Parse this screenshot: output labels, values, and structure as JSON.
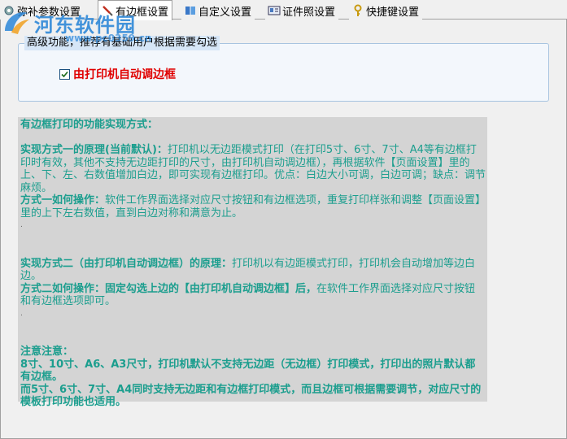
{
  "tabs": [
    {
      "label": "弥补参数设置",
      "icon": "settings-icon"
    },
    {
      "label": "有边框设置",
      "icon": "brush-icon",
      "active": true
    },
    {
      "label": "自定义设置",
      "icon": "book-icon"
    },
    {
      "label": "证件照设置",
      "icon": "id-card-icon"
    },
    {
      "label": "快捷键设置",
      "icon": "key-icon"
    }
  ],
  "watermark": {
    "text": "河东软件园",
    "url": "www.pc0359.cn"
  },
  "group": {
    "title": "高级功能，推荐有基础用户根据需要勾选",
    "checkbox_label": "由打印机自动调边框",
    "checked": true
  },
  "info": {
    "heading": "有边框打印的功能实现方式：",
    "m1_title": "实现方式一的原理(当前默认)：",
    "m1_text": "打印机以无边距模式打印（在打印5寸、6寸、7寸、A4等有边框打印时有效，其他不支持无边距打印的尺寸，由打印机自动调边框），再根据软件【页面设置】里的上、下、左、右数值增加白边，即可实现有边框打印。优点：白边大小可调，白边可调；缺点：调节麻烦。",
    "m1_op_title": "方式一如何操作：",
    "m1_op_text": "软件工作界面选择对应尺寸按钮和有边框选项，重复打印样张和调整【页面设置】里的上下左右数值，直到白边对称和满意为止。",
    "m2_title": "实现方式二（由打印机自动调边框）的原理：",
    "m2_text": "打印机以有边距模式打印，打印机会自动增加等边白边。",
    "m2_op_title": "方式二如何操作：固定勾选上边的【由打印机自动调边框】后，",
    "m2_op_text": "在软件工作界面选择对应尺寸按钮和有边框选项即可。",
    "note_title": "注意注意：",
    "note_1": "8寸、10寸、A6、A3尺寸，打印机默认不支持无边距（无边框）打印模式，打印出的照片默认都有边框。",
    "note_2": "而5寸、6寸、7寸、A4同时支持无边距和有边框打印模式，而且边框可根据需要调节，对应尺寸的模板打印功能也适用。"
  },
  "colors": {
    "info_text": "#1b9e8e",
    "info_bg": "#d4d4d4",
    "checkbox_label": "#e00000",
    "watermark": "#2a86d8"
  }
}
